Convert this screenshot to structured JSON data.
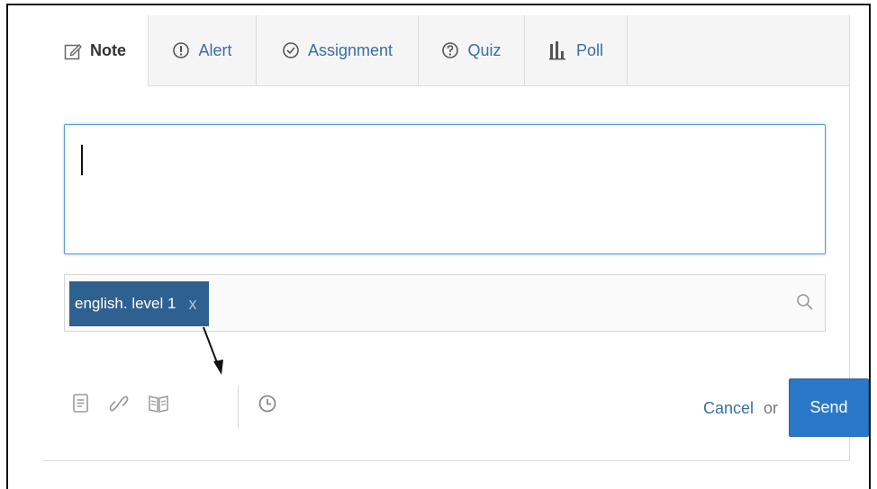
{
  "tabs": [
    {
      "label": "Note",
      "icon": "edit-icon",
      "active": true
    },
    {
      "label": "Alert",
      "icon": "alert-icon",
      "active": false
    },
    {
      "label": "Assignment",
      "icon": "check-circle-icon",
      "active": false
    },
    {
      "label": "Quiz",
      "icon": "question-circle-icon",
      "active": false
    },
    {
      "label": "Poll",
      "icon": "bar-chart-icon",
      "active": false
    }
  ],
  "editor": {
    "value": ""
  },
  "recipients": {
    "chips": [
      {
        "label": "english. level 1",
        "remove": "x"
      }
    ],
    "search_icon": "search-icon"
  },
  "toolbar": {
    "icons": [
      "file-icon",
      "link-icon",
      "library-icon",
      "clock-icon"
    ],
    "cancel_label": "Cancel",
    "or_label": "or",
    "send_label": "Send"
  },
  "colors": {
    "accent": "#2b78c9",
    "chip": "#2f6190",
    "link": "#3a6ea5",
    "tabbar": "#f5f5f5"
  }
}
